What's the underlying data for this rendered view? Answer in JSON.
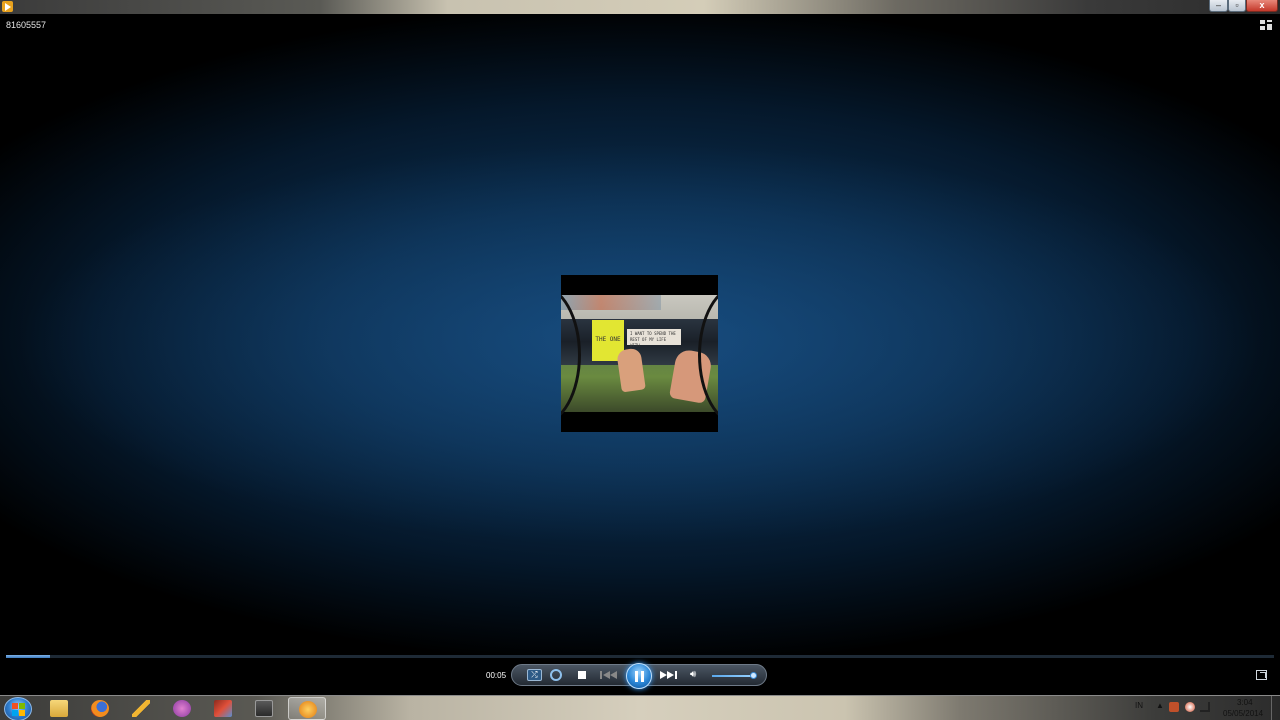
{
  "window": {
    "controls": {
      "minimize": "–",
      "maximize": "▫",
      "close": "x"
    }
  },
  "player": {
    "media_title": "81605557",
    "album_art_text": {
      "sticky_note": "THE ONE",
      "paper": "I WANT TO SPEND THE REST OF MY LIFE WITH"
    },
    "elapsed": "00:05",
    "seek_progress_fraction": 0.035,
    "volume_fraction": 0.9,
    "state": "playing"
  },
  "taskbar": {
    "items": [
      {
        "name": "windows-explorer",
        "icon": "folder-icon",
        "active": false
      },
      {
        "name": "firefox",
        "icon": "firefox-icon",
        "active": false
      },
      {
        "name": "app-3",
        "icon": "pen-icon",
        "active": false
      },
      {
        "name": "app-4",
        "icon": "chat-icon",
        "active": false
      },
      {
        "name": "app-5",
        "icon": "paint-icon",
        "active": false
      },
      {
        "name": "app-6",
        "icon": "media-icon",
        "active": false
      },
      {
        "name": "windows-media-player",
        "icon": "wmp-icon",
        "active": true
      }
    ],
    "tray": {
      "language": "IN",
      "show_hidden": "▲",
      "time": "3:04",
      "date": "05/05/2014"
    }
  },
  "colors": {
    "accent": "#2a86d6",
    "video_bg_center": "#0f3d66"
  }
}
